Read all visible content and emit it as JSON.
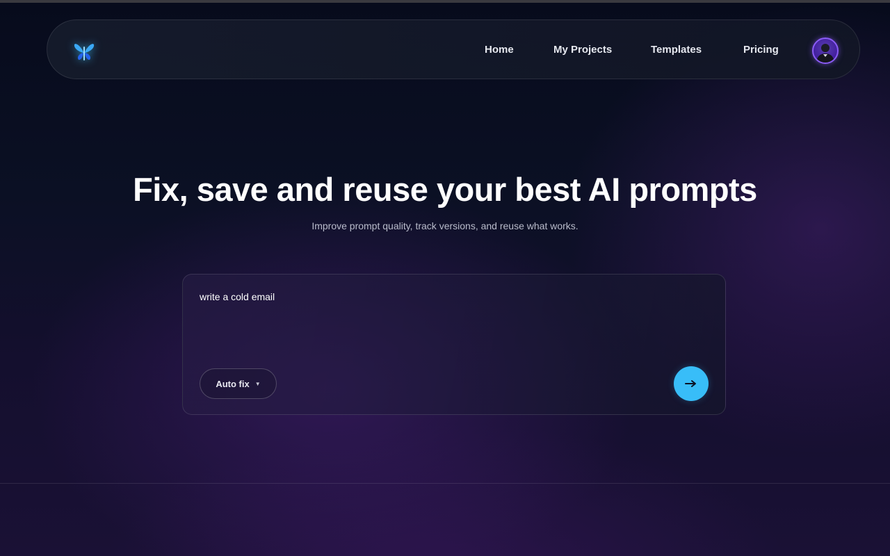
{
  "nav": {
    "logo_icon": "butterfly-icon",
    "links": [
      {
        "label": "Home"
      },
      {
        "label": "My Projects"
      },
      {
        "label": "Templates"
      },
      {
        "label": "Pricing"
      }
    ],
    "avatar_icon": "user-avatar"
  },
  "hero": {
    "title": "Fix, save and reuse your best AI prompts",
    "subtitle": "Improve prompt quality, track versions, and reuse what works."
  },
  "prompt": {
    "value": "write a cold email",
    "mode_selected": "Auto fix",
    "submit_icon": "arrow-right-icon"
  },
  "colors": {
    "accent": "#38bdf8",
    "avatar_ring": "#8b5cf6",
    "background": "#0a0d1f"
  }
}
